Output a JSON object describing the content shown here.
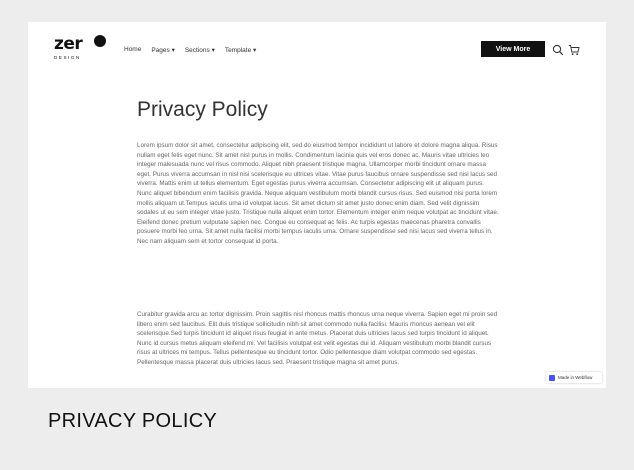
{
  "nav": {
    "logo_word": "zer",
    "logo_sub": "DESIGN",
    "menu": [
      "Home",
      "Pages ▾",
      "Sections ▾",
      "Template ▾"
    ],
    "cta_label": "View More"
  },
  "icons": [
    "search-icon",
    "cart-icon"
  ],
  "page": {
    "title": "Privacy Policy",
    "paragraph_1": "Lorem ipsum dolor sit amet, consectetur adipiscing elit, sed do eiusmod tempor incididunt ut labore et dolore magna aliqua. Risus nullam eget felis eget nunc. Sit amet nisl purus in mollis. Condimentum lacinia quis vel eros donec ac. Mauris vitae ultricies leo integer malesuada nunc vel risus commodo. Aliquet nibh praesent tristique magna. Ullamcorper morbi tincidunt ornare massa eget. Purus viverra accumsan in nisl nisi scelerisque eu ultrices vitae. Vitae purus faucibus ornare suspendisse sed nisi lacus sed viverra. Mattis enim ut tellus elementum. Eget egestas purus viverra accumsan. Consectetur adipiscing elit ut aliquam purus. Nunc aliquet bibendum enim facilisis gravida. Neque aliquam vestibulum morbi blandit cursus risus. Sed euismod nisi porta lorem mollis aliquam ut.Tempus iaculis urna id volutpat lacus. Sit amet dictum sit amet justo donec enim diam. Sed velit dignissim sodales ut eu sem integer vitae justo. Tristique nulla aliquet enim tortor. Elementum integer enim neque volutpat ac tincidunt vitae. Eleifend donec pretium vulputate sapien nec. Congue eu consequat ac felis. Ac turpis egestas maecenas pharetra convallis posuere morbi leo urna. Sit amet nulla facilisi morbi tempus iaculis urna. Ornare suspendisse sed nisi lacus sed viverra tellus in. Nec nam aliquam sem et tortor consequat id porta.",
    "paragraph_2": "Curabitur gravida arcu ac tortor dignissim. Proin sagittis nisl rhoncus mattis rhoncus urna neque viverra. Sapien eget mi proin sed libero enim sed faucibus. Elit duis tristique sollicitudin nibh sit amet commodo nulla facilisi. Mauris rhoncus aenean vel elit scelerisque.Sed turpis tincidunt id aliquet risus feugiat in ante metus. Placerat duis ultricies lacus sed turpis tincidunt id aliquet. Nunc id cursus metus aliquam eleifend mi. Vel facilisis volutpat est velit egestas dui id. Aliquam vestibulum morbi blandit cursus risus at ultrices mi tempus. Tellus pellentesque eu tincidunt tortor. Odio pellentesque diam volutpat commodo sed egestas. Pellentesque massa placerat duis ultricies lacus sed. Praesent tristique magna sit amet purus."
  },
  "badge": {
    "label": "Made in Webflow"
  },
  "caption": "PRIVACY POLICY"
}
